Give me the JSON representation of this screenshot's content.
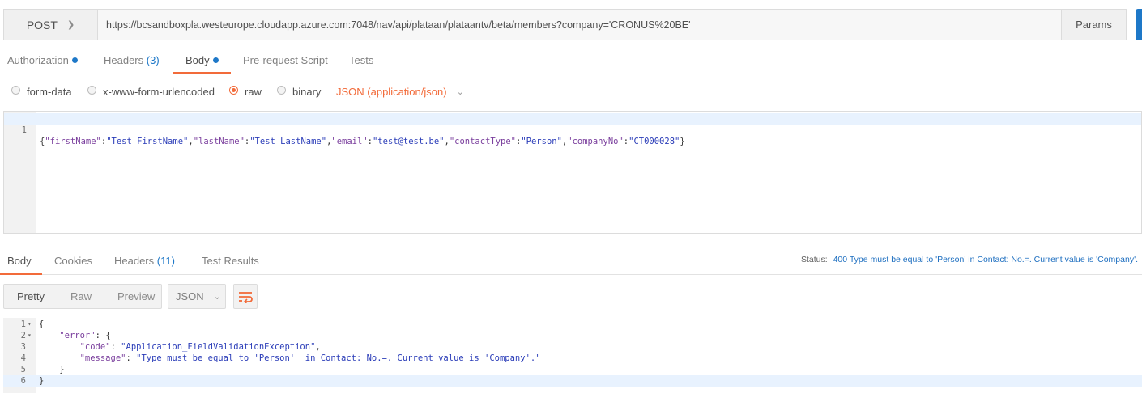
{
  "request": {
    "method": "POST",
    "url": "https://bcsandboxpla.westeurope.cloudapp.azure.com:7048/nav/api/plataan/plataantv/beta/members?company='CRONUS%20BE'",
    "params_label": "Params"
  },
  "request_tabs": [
    {
      "label": "Authorization",
      "dot": true
    },
    {
      "label": "Headers",
      "count": "(3)"
    },
    {
      "label": "Body",
      "dot": true,
      "active": true
    },
    {
      "label": "Pre-request Script"
    },
    {
      "label": "Tests"
    }
  ],
  "body_types": [
    {
      "label": "form-data",
      "selected": false
    },
    {
      "label": "x-www-form-urlencoded",
      "selected": false
    },
    {
      "label": "raw",
      "selected": true
    },
    {
      "label": "binary",
      "selected": false
    }
  ],
  "content_type": "JSON (application/json)",
  "request_body": {
    "line_number": "1",
    "tokens": [
      {
        "t": "p",
        "v": "{"
      },
      {
        "t": "k",
        "v": "\"firstName\""
      },
      {
        "t": "p",
        "v": ":"
      },
      {
        "t": "s",
        "v": "\"Test FirstName\""
      },
      {
        "t": "p",
        "v": ","
      },
      {
        "t": "k",
        "v": "\"lastName\""
      },
      {
        "t": "p",
        "v": ":"
      },
      {
        "t": "s",
        "v": "\"Test LastName\""
      },
      {
        "t": "p",
        "v": ","
      },
      {
        "t": "k",
        "v": "\"email\""
      },
      {
        "t": "p",
        "v": ":"
      },
      {
        "t": "s",
        "v": "\"test@test.be\""
      },
      {
        "t": "p",
        "v": ","
      },
      {
        "t": "k",
        "v": "\"contactType\""
      },
      {
        "t": "p",
        "v": ":"
      },
      {
        "t": "s",
        "v": "\"Person\""
      },
      {
        "t": "p",
        "v": ","
      },
      {
        "t": "k",
        "v": "\"companyNo\""
      },
      {
        "t": "p",
        "v": ":"
      },
      {
        "t": "s",
        "v": "\"CT000028\""
      },
      {
        "t": "p",
        "v": "}"
      }
    ]
  },
  "response_tabs": [
    {
      "label": "Body",
      "active": true
    },
    {
      "label": "Cookies"
    },
    {
      "label": "Headers",
      "count": "(11)"
    },
    {
      "label": "Test Results"
    }
  ],
  "status": {
    "label": "Status:",
    "value": "400 Type must be equal to 'Person' in Contact: No.=. Current value is 'Company'."
  },
  "format_buttons": [
    {
      "label": "Pretty",
      "active": true
    },
    {
      "label": "Raw"
    },
    {
      "label": "Preview"
    }
  ],
  "format_select": "JSON",
  "wrap_icon": "wrap-lines-icon",
  "response_body": [
    {
      "n": "1",
      "fold": true,
      "tokens": [
        {
          "t": "p",
          "v": "{"
        }
      ]
    },
    {
      "n": "2",
      "fold": true,
      "tokens": [
        {
          "t": "p",
          "v": "    "
        },
        {
          "t": "k",
          "v": "\"error\""
        },
        {
          "t": "p",
          "v": ": {"
        }
      ]
    },
    {
      "n": "3",
      "tokens": [
        {
          "t": "p",
          "v": "        "
        },
        {
          "t": "k",
          "v": "\"code\""
        },
        {
          "t": "p",
          "v": ": "
        },
        {
          "t": "s",
          "v": "\"Application_FieldValidationException\""
        },
        {
          "t": "p",
          "v": ","
        }
      ]
    },
    {
      "n": "4",
      "tokens": [
        {
          "t": "p",
          "v": "        "
        },
        {
          "t": "k",
          "v": "\"message\""
        },
        {
          "t": "p",
          "v": ": "
        },
        {
          "t": "s",
          "v": "\"Type must be equal to 'Person'  in Contact: No.=. Current value is 'Company'.\""
        }
      ]
    },
    {
      "n": "5",
      "tokens": [
        {
          "t": "p",
          "v": "    }"
        }
      ]
    },
    {
      "n": "6",
      "hl": true,
      "tokens": [
        {
          "t": "p",
          "v": "}"
        }
      ]
    }
  ],
  "colors": {
    "accent": "#f26b3a",
    "link": "#1e78c8",
    "json_key": "#7a3e9d",
    "json_string": "#2a3cb8"
  }
}
